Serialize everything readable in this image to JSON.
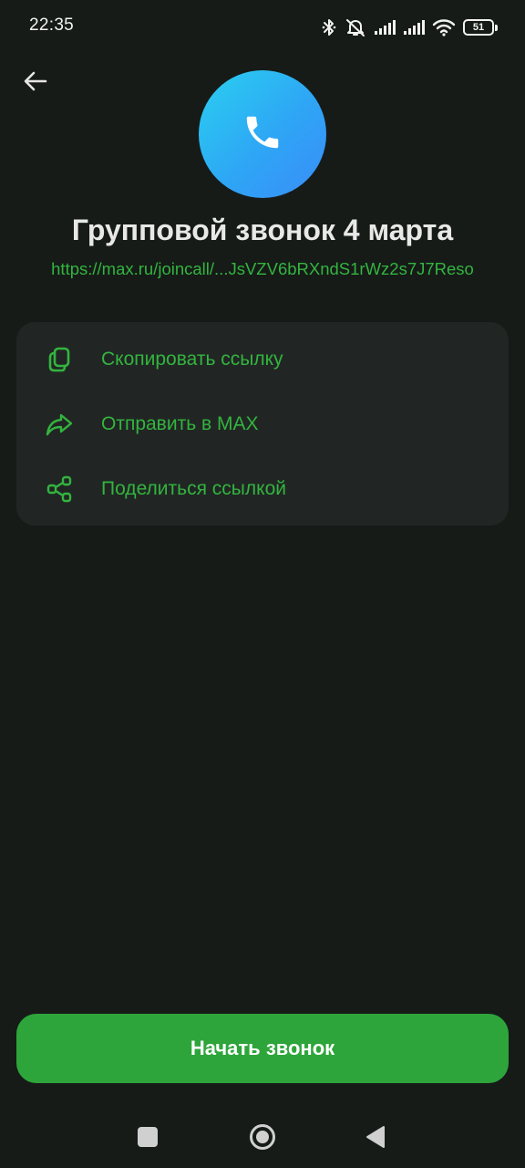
{
  "status_bar": {
    "time": "22:35",
    "battery_level": "51",
    "icons": [
      "bluetooth-icon",
      "mute-icon",
      "signal-icon",
      "signal-icon",
      "wifi-icon",
      "battery-icon"
    ]
  },
  "header": {
    "back_icon": "arrow-left-icon",
    "avatar_icon": "phone-icon"
  },
  "call": {
    "title": "Групповой звонок 4 марта",
    "link": "https://max.ru/joincall/...JsVZV6bRXndS1rWz2s7J7Reso"
  },
  "actions": [
    {
      "label": "Скопировать ссылку",
      "icon": "copy-icon"
    },
    {
      "label": "Отправить в MAX",
      "icon": "forward-icon"
    },
    {
      "label": "Поделиться ссылкой",
      "icon": "share-icon"
    }
  ],
  "start_button": {
    "label": "Начать звонок"
  },
  "colors": {
    "background": "#161b18",
    "accent": "#33b43f",
    "button": "#2ea53b",
    "card": "#212624",
    "avatar_gradient_start": "#2ad0f0",
    "avatar_gradient_end": "#3a8cf7"
  }
}
